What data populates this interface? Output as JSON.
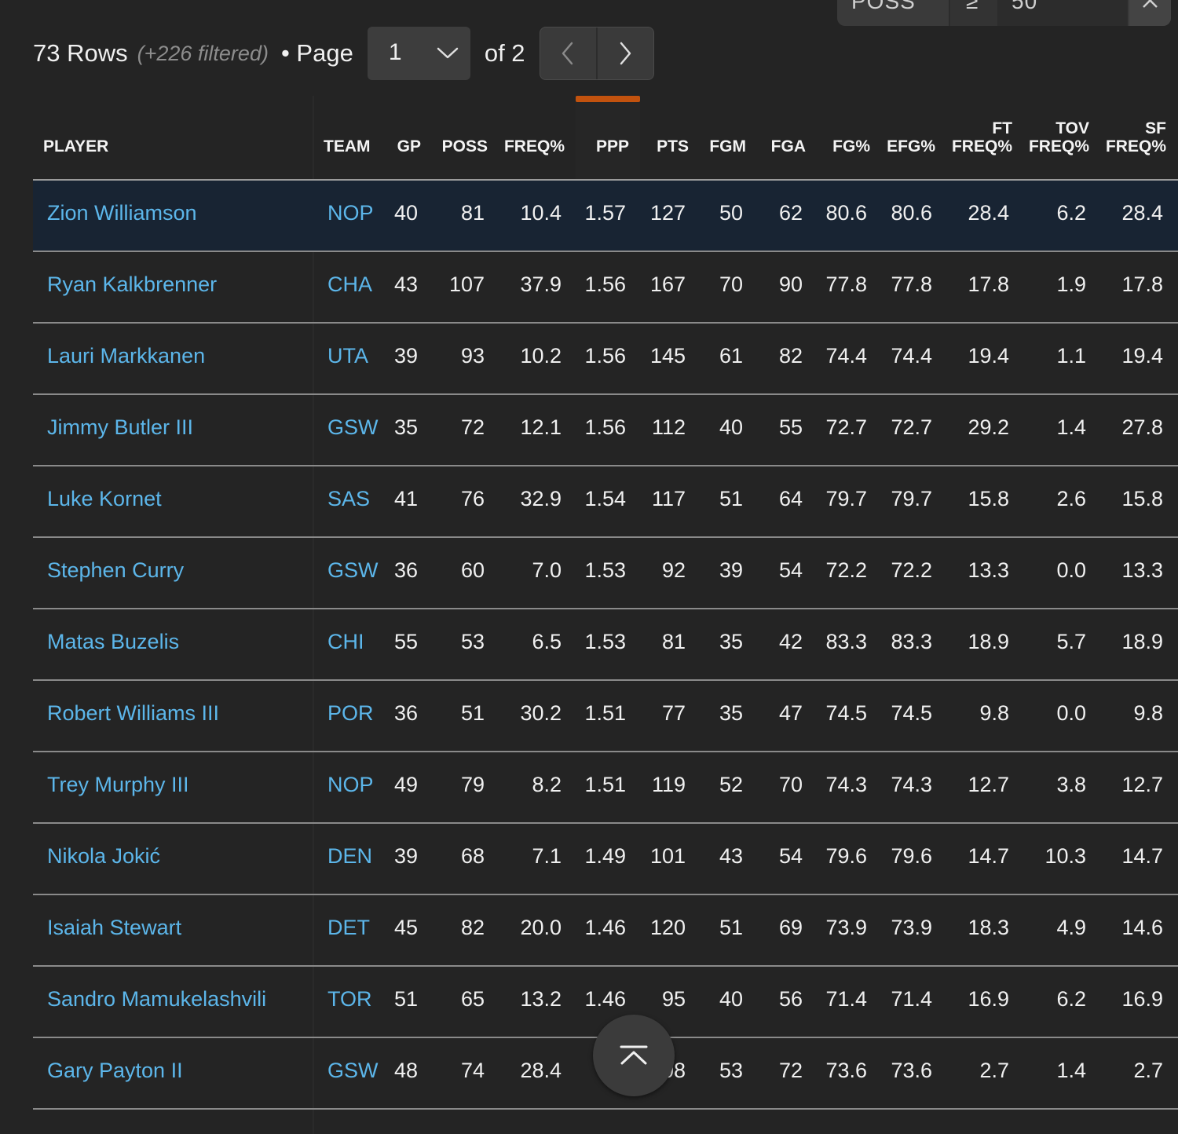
{
  "filter_bar": {
    "field_text": "POSS",
    "operator_text": "≥",
    "value_text": "50",
    "clear_icon": "close-icon"
  },
  "pager": {
    "rows_count": "73 Rows",
    "filtered_text": "(+226 filtered)",
    "page_label": "• Page",
    "current_page": "1",
    "of_text": "of 2",
    "prev_icon": "chevron-left-icon",
    "next_icon": "chevron-right-icon",
    "dropdown_icon": "chevron-down-icon"
  },
  "colors": {
    "background": "#242424",
    "link": "#5cb6ea",
    "sort_accent": "#c2520e",
    "highlight_row": "#182433"
  },
  "table": {
    "sorted_column": "PPP",
    "columns": [
      {
        "key": "player",
        "label": "PLAYER"
      },
      {
        "key": "team",
        "label": "TEAM"
      },
      {
        "key": "gp",
        "label": "GP"
      },
      {
        "key": "poss",
        "label": "POSS"
      },
      {
        "key": "freq",
        "label": "FREQ%"
      },
      {
        "key": "ppp",
        "label": "PPP"
      },
      {
        "key": "pts",
        "label": "PTS"
      },
      {
        "key": "fgm",
        "label": "FGM"
      },
      {
        "key": "fga",
        "label": "FGA"
      },
      {
        "key": "fgp",
        "label": "FG%"
      },
      {
        "key": "efg",
        "label": "EFG%"
      },
      {
        "key": "ft",
        "label": "FT FREQ%"
      },
      {
        "key": "tov",
        "label": "TOV FREQ%"
      },
      {
        "key": "sf",
        "label": "SF FREQ%"
      }
    ],
    "rows": [
      [
        "Zion Williamson",
        "NOP",
        "40",
        "81",
        "10.4",
        "1.57",
        "127",
        "50",
        "62",
        "80.6",
        "80.6",
        "28.4",
        "6.2",
        "28.4"
      ],
      [
        "Ryan Kalkbrenner",
        "CHA",
        "43",
        "107",
        "37.9",
        "1.56",
        "167",
        "70",
        "90",
        "77.8",
        "77.8",
        "17.8",
        "1.9",
        "17.8"
      ],
      [
        "Lauri Markkanen",
        "UTA",
        "39",
        "93",
        "10.2",
        "1.56",
        "145",
        "61",
        "82",
        "74.4",
        "74.4",
        "19.4",
        "1.1",
        "19.4"
      ],
      [
        "Jimmy Butler III",
        "GSW",
        "35",
        "72",
        "12.1",
        "1.56",
        "112",
        "40",
        "55",
        "72.7",
        "72.7",
        "29.2",
        "1.4",
        "27.8"
      ],
      [
        "Luke Kornet",
        "SAS",
        "41",
        "76",
        "32.9",
        "1.54",
        "117",
        "51",
        "64",
        "79.7",
        "79.7",
        "15.8",
        "2.6",
        "15.8"
      ],
      [
        "Stephen Curry",
        "GSW",
        "36",
        "60",
        "7.0",
        "1.53",
        "92",
        "39",
        "54",
        "72.2",
        "72.2",
        "13.3",
        "0.0",
        "13.3"
      ],
      [
        "Matas Buzelis",
        "CHI",
        "55",
        "53",
        "6.5",
        "1.53",
        "81",
        "35",
        "42",
        "83.3",
        "83.3",
        "18.9",
        "5.7",
        "18.9"
      ],
      [
        "Robert Williams III",
        "POR",
        "36",
        "51",
        "30.2",
        "1.51",
        "77",
        "35",
        "47",
        "74.5",
        "74.5",
        "9.8",
        "0.0",
        "9.8"
      ],
      [
        "Trey Murphy III",
        "NOP",
        "49",
        "79",
        "8.2",
        "1.51",
        "119",
        "52",
        "70",
        "74.3",
        "74.3",
        "12.7",
        "3.8",
        "12.7"
      ],
      [
        "Nikola Jokić",
        "DEN",
        "39",
        "68",
        "7.1",
        "1.49",
        "101",
        "43",
        "54",
        "79.6",
        "79.6",
        "14.7",
        "10.3",
        "14.7"
      ],
      [
        "Isaiah Stewart",
        "DET",
        "45",
        "82",
        "20.0",
        "1.46",
        "120",
        "51",
        "69",
        "73.9",
        "73.9",
        "18.3",
        "4.9",
        "14.6"
      ],
      [
        "Sandro Mamukelashvili",
        "TOR",
        "51",
        "65",
        "13.2",
        "1.46",
        "95",
        "40",
        "56",
        "71.4",
        "71.4",
        "16.9",
        "6.2",
        "16.9"
      ],
      [
        "Gary Payton II",
        "GSW",
        "48",
        "74",
        "28.4",
        "1",
        "08",
        "53",
        "72",
        "73.6",
        "73.6",
        "2.7",
        "1.4",
        "2.7"
      ]
    ]
  },
  "scroll_top_icon": "arrow-up-icon"
}
